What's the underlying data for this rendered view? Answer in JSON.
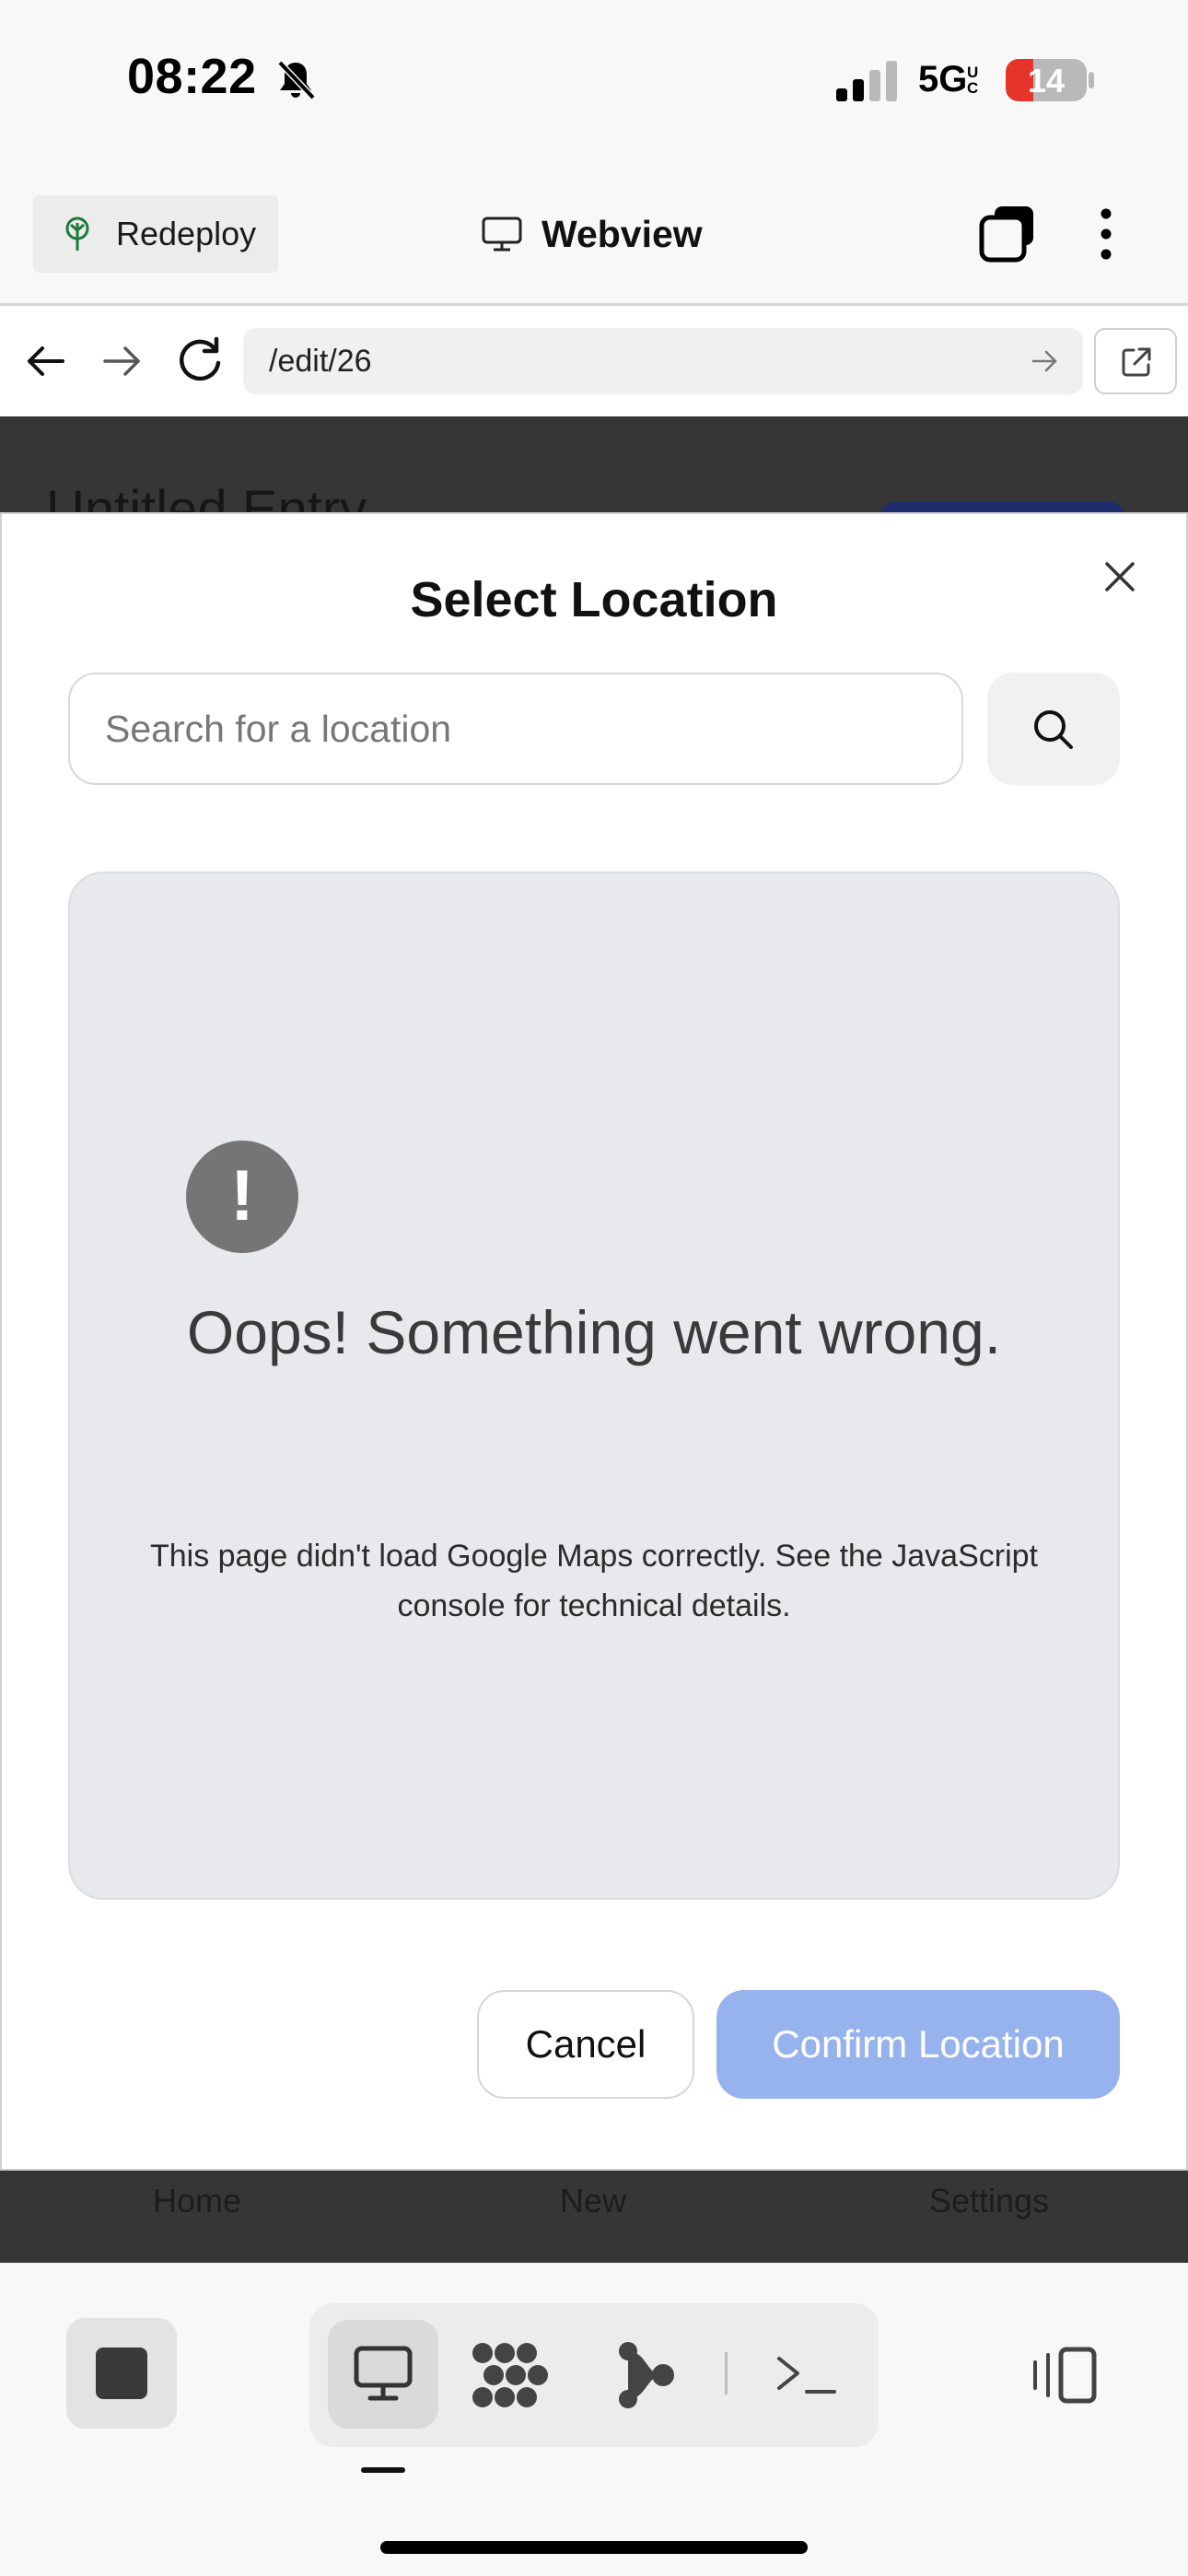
{
  "status_bar": {
    "time": "08:22",
    "network": "5G",
    "network_sub": "UC",
    "battery": "14"
  },
  "header": {
    "redeploy_label": "Redeploy",
    "title": "Webview"
  },
  "url_bar": {
    "path": "/edit/26"
  },
  "page_behind": {
    "title": "Untitled Entry",
    "nav": [
      "Home",
      "New",
      "Settings"
    ]
  },
  "modal": {
    "title": "Select Location",
    "search_placeholder": "Search for a location",
    "error_heading": "Oops! Something went wrong.",
    "error_message": "This page didn't load Google Maps correctly. See the JavaScript console for technical details.",
    "cancel_label": "Cancel",
    "confirm_label": "Confirm Location"
  },
  "colors": {
    "accent_disabled": "#97b3ee",
    "backdrop": "#363637",
    "map_error_bg": "#e8e9ec"
  },
  "icons": [
    "bell-slash-icon",
    "signal-icon",
    "tree-icon",
    "monitor-icon",
    "tabs-icon",
    "more-vertical-icon",
    "back-arrow-icon",
    "forward-arrow-icon",
    "reload-icon",
    "arrow-right-icon",
    "external-link-icon",
    "close-icon",
    "search-icon",
    "exclamation-icon",
    "stop-icon",
    "apps-icon",
    "flow-icon",
    "terminal-icon",
    "panel-toggle-icon"
  ]
}
